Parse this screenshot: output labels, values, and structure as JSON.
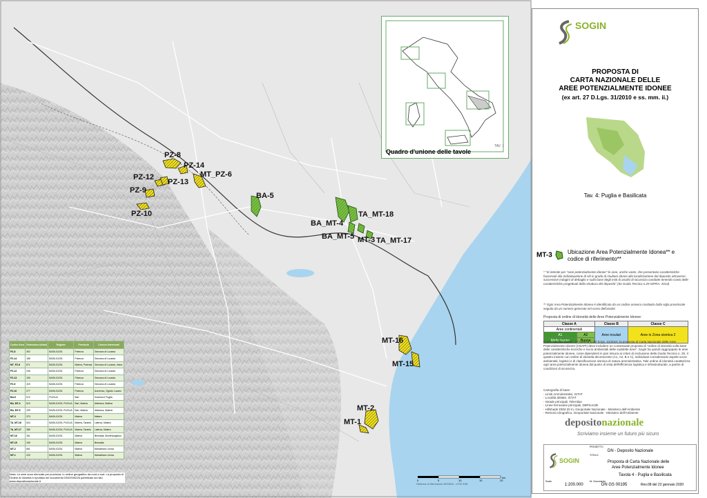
{
  "map": {
    "area_labels": [
      {
        "id": "PZ-8",
        "text": "PZ-8"
      },
      {
        "id": "PZ-14",
        "text": "PZ-14"
      },
      {
        "id": "MT_PZ-6",
        "text": "MT_PZ-6"
      },
      {
        "id": "PZ-12",
        "text": "PZ-12"
      },
      {
        "id": "PZ-13",
        "text": "PZ-13"
      },
      {
        "id": "PZ-9",
        "text": "PZ-9"
      },
      {
        "id": "PZ-10",
        "text": "PZ-10"
      },
      {
        "id": "BA-5",
        "text": "BA-5"
      },
      {
        "id": "TA_MT-18",
        "text": "TA_MT-18"
      },
      {
        "id": "BA_MT-4",
        "text": "BA_MT-4"
      },
      {
        "id": "BA_MT-5",
        "text": "BA_MT-5"
      },
      {
        "id": "MT-3",
        "text": "MT-3"
      },
      {
        "id": "TA_MT-17",
        "text": "TA_MT-17"
      },
      {
        "id": "MT-16",
        "text": "MT-16"
      },
      {
        "id": "MT-15",
        "text": "MT-15"
      },
      {
        "id": "MT-2",
        "text": "MT-2"
      },
      {
        "id": "MT-1",
        "text": "MT-1"
      }
    ],
    "colors": {
      "land": "#d9d9d9",
      "sea": "#a8d4ef",
      "class_a": "#7bc142",
      "class_c": "#f2e21c",
      "roads": "#ffffff",
      "borders": "#333333"
    }
  },
  "inset": {
    "title": "Quadro d'unione delle tavole",
    "tav1": "TAV. 1",
    "tav_labels": [
      "TAV. 2",
      "TAV. 3",
      "TAV. 4",
      "TAV. 5",
      "TAV. 6"
    ]
  },
  "panel": {
    "logo": "SOGIN",
    "title_lines": [
      "PROPOSTA DI",
      "CARTA NAZIONALE DELLE",
      "AREE POTENZIALMENTE IDONEE",
      "(ex art. 27 D.Lgs. 31/2010 e ss. mm. ii.)"
    ],
    "tav": "Tav. 4: Puglia e Basilicata"
  },
  "legend": {
    "symbol_code": "MT-3",
    "symbol_desc": "Ubicazione Area Potenzialmente Idonea** e codice di riferimento**",
    "note1": "* \"Si intende per \"aree potenzialmente idonee\" le aree, anche vaste, che presentano caratteristiche favorevoli alla individuazione di siti in grado di risultare idonei alla localizzazione del deposito attraverso successive indagini di dettaglio e sulla base degli esiti di analisi di sicurezza condotte tenendo conto delle caratteristiche progettuali della struttura del deposito\" (da Guida Tecnica n.29 ISPRA, 2014)",
    "note2": "** Ogni Area Potenzialmente Idonea è identificata da un codice univoco costituito dalla sigla provinciale seguita da un numero generato nel corso dell'analisi",
    "idoneity_title": "Proposta di ordine di idoneità delle Aree Potenzialmente Idonee:",
    "class_a": "Classe A",
    "class_b": "Classe B",
    "class_c": "Classe C",
    "continental": "Aree continentali",
    "a1": "A1",
    "a1_sub": "Molto buone",
    "a2": "A2",
    "a2_sub": "Buone",
    "b_desc": "Aree insulari",
    "c_desc": "Aree in Zona sismica 2",
    "body": "Come stabilito dall'art. 27 comma 1 del D.lgs. 31/2010, la proposta di Carta Nazionale delle Aree Potenzialmente Idonee (CNAPI) deve includere un contestuale proposta di \"ordine di idoneità sulla base delle caratteristiche tecniche e socio-ambientali delle suddette aree\". Sogin ha quindi raggruppato le aree potenzialmente idonee, come dipendenti in pari misura ai criteri di esclusione della Guida Tecnica n. 29. Il quattro insiemi con ordine di idoneità decrescente (A1, A2, B e C), individuati considerando aspetti socio-ambientali, logistici e di classificazione sismica di natura amministrativa. Tale ordine di idoneità caratterizza ogni area potenzialmente idonea dal punto di vista dell'efficienza logistica e infrastrutturale, a partire di condizioni di sicurezza.",
    "carto_title": "Cartografia di base:",
    "carto_items": [
      "- Limiti Amministrativi, ISTAT",
      "- Località abitate, ISTAT",
      "- Strade principali, TeleAtlas",
      "- Linee ferroviarie principali, DBPrior10k",
      "- Hillshade DEM 20 m, Geoportale Nazionale - Ministero dell'Ambiente",
      "- Reticolo idrografico, Geoportale Nazionale - Ministero dell'Ambiente"
    ]
  },
  "branding": {
    "deposito_a": "deposito",
    "deposito_b": "nazionale",
    "slogan": "Scriviamo insieme un futuro più sicuro"
  },
  "titleblock": {
    "logo": "SOGIN",
    "progetto_label": "PROGETTO",
    "progetto": "DN - Deposito Nazionale",
    "titolo_label": "TITOLO",
    "titolo_1": "Proposta di Carta Nazionale delle",
    "titolo_2": "Aree Potenzialmente Idonee",
    "tavola": "Tavola 4 - Puglia e Basilicata",
    "scala_label": "Scala",
    "scale": "1:200.000",
    "doc_label": "Nr. Documento",
    "doc": "DN GS 00195",
    "rev": "Rev.08 del 22 gennaio 2020"
  },
  "table": {
    "headers": [
      "Codice Area",
      "Estensione (ettari)",
      "Regione",
      "Provincia",
      "Comuni Interessati"
    ],
    "rows": [
      [
        "PZ-8",
        "392",
        "BASILICATA",
        "Potenza",
        "Genzano di Lucania"
      ],
      [
        "PZ-14",
        "185",
        "BASILICATA",
        "Potenza",
        "Genzano di Lucania"
      ],
      [
        "MT_PZ-6",
        "671",
        "BASILICATA",
        "Matera, Potenza",
        "Genzano di Lucania, Irsina"
      ],
      [
        "PZ-12",
        "246",
        "BASILICATA",
        "Potenza",
        "Genzano di Lucania"
      ],
      [
        "PZ-13",
        "153",
        "BASILICATA",
        "Potenza",
        "Genzano di Lucania"
      ],
      [
        "PZ-9",
        "319",
        "BASILICATA",
        "Potenza",
        "Genzano di Lucania"
      ],
      [
        "PZ-10",
        "277",
        "BASILICATA",
        "Potenza",
        "Acerenza, Oppido Lucano"
      ],
      [
        "BA-5",
        "672",
        "PUGLIA",
        "Bari",
        "Gravina in Puglia"
      ],
      [
        "BA_MT-4",
        "613",
        "BASILICATA, PUGLIA",
        "Bari, Matera",
        "Altamura, Matera"
      ],
      [
        "BA_MT-5",
        "209",
        "BASILICATA, PUGLIA",
        "Bari, Matera",
        "Altamura, Matera"
      ],
      [
        "MT-3",
        "373",
        "BASILICATA",
        "Matera",
        "Matera"
      ],
      [
        "TA_MT-18",
        "524",
        "BASILICATA, PUGLIA",
        "Matera, Taranto",
        "Laterza, Matera"
      ],
      [
        "TA_MT-17",
        "385",
        "BASILICATA, PUGLIA",
        "Matera, Taranto",
        "Laterza, Matera"
      ],
      [
        "MT-16",
        "261",
        "BASILICATA",
        "Matera",
        "Bernalda, Montescaglioso"
      ],
      [
        "MT-15",
        "205",
        "BASILICATA",
        "Matera",
        "Bernalda"
      ],
      [
        "MT-2",
        "661",
        "BASILICATA",
        "Matera",
        "Montalbano Jonico"
      ],
      [
        "MT-1",
        "220",
        "BASILICATA",
        "Matera",
        "Montalbano Jonico"
      ]
    ],
    "note": "Nota: Le aree sono elencate per provincia, in ordine geografico da nord a sud. La proposta di Ordine di Idoneità è riportata nel documento DNGS00226 pubblicato sul sito www.depositonazionale.it"
  },
  "scalebar": {
    "ticks": [
      "0",
      "5",
      "10",
      "15",
      "20"
    ],
    "unit": "km",
    "caption": "Sistema di riferimento WGS84 - UTM 33N"
  }
}
